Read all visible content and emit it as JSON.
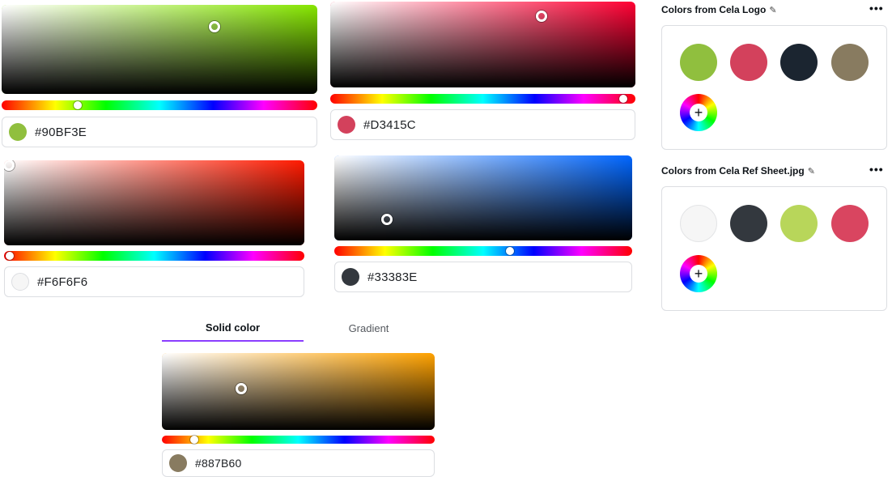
{
  "pickers": [
    {
      "hex": "#90BF3E",
      "hue_color": "#86e600",
      "hue_position": 0.24
    },
    {
      "hex": "#D3415C",
      "hue_color": "#ff0033",
      "hue_position": 0.96
    },
    {
      "hex": "#F6F6F6",
      "hue_color": "#ff1a00",
      "hue_position": 0.02
    },
    {
      "hex": "#33383E",
      "hue_color": "#0066ff",
      "hue_position": 0.59
    },
    {
      "hex": "#887B60",
      "hue_color": "#ffa200",
      "hue_position": 0.12
    }
  ],
  "tabs": {
    "solid": "Solid color",
    "gradient": "Gradient"
  },
  "panels": {
    "logo": {
      "title": "Colors from Cela Logo",
      "colors": [
        "#90BF3E",
        "#D3415C",
        "#1B2530",
        "#887B60"
      ]
    },
    "ref": {
      "title": "Colors from Cela Ref Sheet.jpg",
      "colors": [
        "#F6F6F6",
        "#33383E",
        "#B8D65A",
        "#D94560"
      ]
    }
  },
  "icons": {
    "edit": "pencil-icon",
    "more": "more-options-icon",
    "add": "add-color-icon"
  }
}
